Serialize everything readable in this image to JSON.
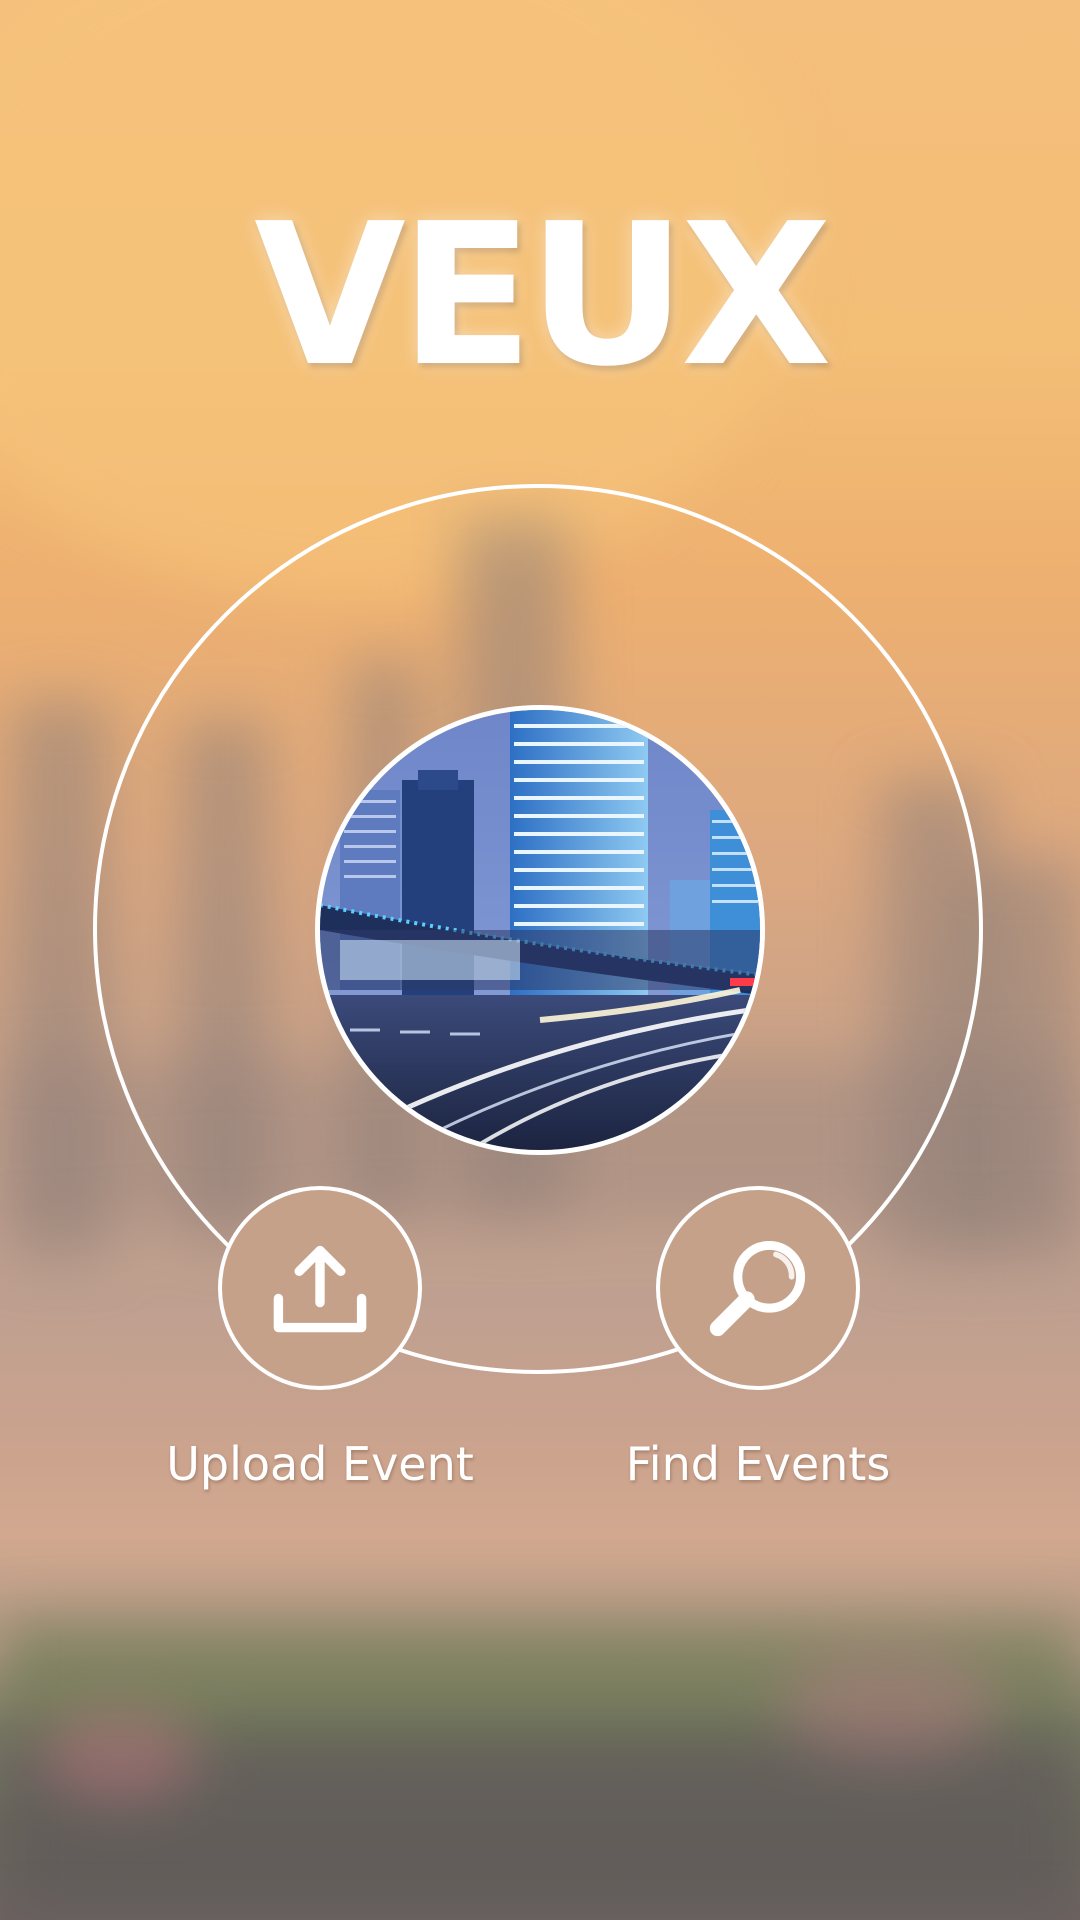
{
  "app": {
    "brand": "VEUX"
  },
  "hero": {
    "image_icon": "city-night-photo"
  },
  "actions": [
    {
      "label": "Upload Event",
      "icon": "upload-icon"
    },
    {
      "label": "Find Events",
      "icon": "search-icon"
    }
  ],
  "colors": {
    "accent": "#ffffff",
    "background_top": "#f4bf7c",
    "background_bottom": "#6f6462"
  }
}
